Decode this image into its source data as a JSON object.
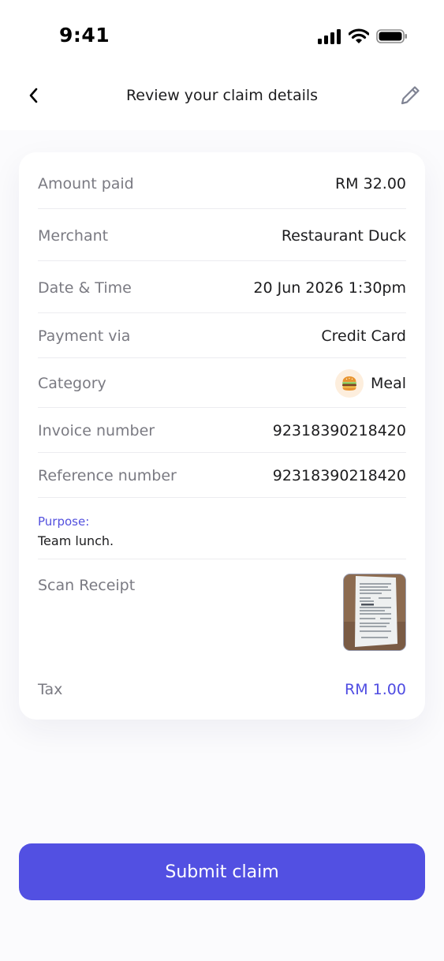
{
  "status_bar": {
    "time": "9:41"
  },
  "header": {
    "title": "Review your claim details"
  },
  "details": {
    "amount_paid": {
      "label": "Amount paid",
      "value": "RM 32.00"
    },
    "merchant": {
      "label": "Merchant",
      "value": "Restaurant Duck"
    },
    "date_time": {
      "label": "Date & Time",
      "value": "20 Jun 2026 1:30pm"
    },
    "payment_via": {
      "label": "Payment via",
      "value": "Credit Card"
    },
    "category": {
      "label": "Category",
      "value": "Meal",
      "icon": "hamburger-icon"
    },
    "invoice_number": {
      "label": "Invoice number",
      "value": "92318390218420"
    },
    "reference_number": {
      "label": "Reference number",
      "value": "92318390218420"
    },
    "purpose": {
      "label": "Purpose:",
      "value": "Team lunch."
    },
    "scan_receipt": {
      "label": "Scan Receipt"
    },
    "tax": {
      "label": "Tax",
      "value": "RM 1.00"
    }
  },
  "actions": {
    "submit_label": "Submit claim"
  },
  "colors": {
    "accent": "#5250e2",
    "label_gray": "#7a7a82",
    "category_badge_bg": "#fdeedd"
  }
}
